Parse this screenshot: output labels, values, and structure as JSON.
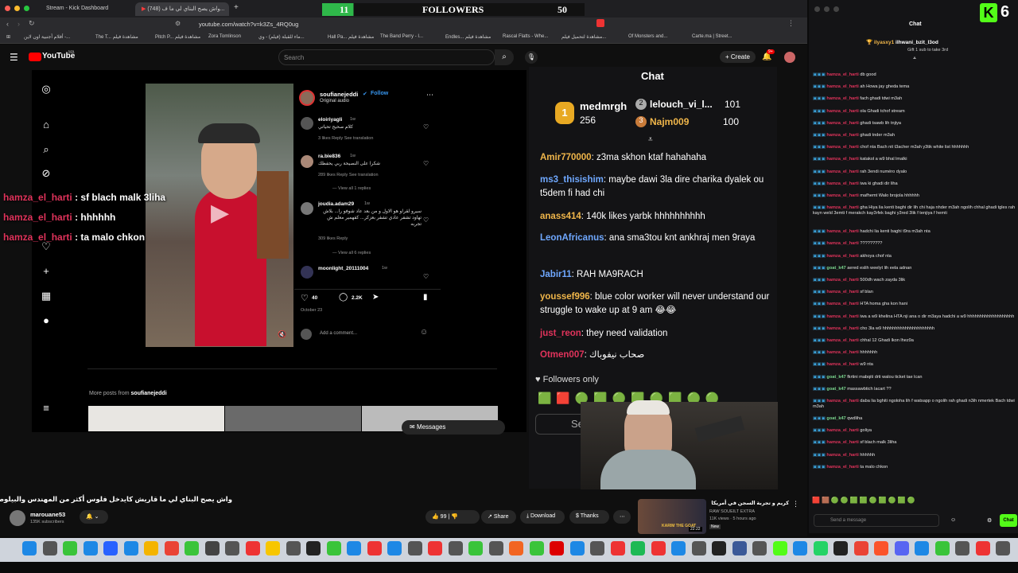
{
  "browser": {
    "tabs": [
      "Stream - Kick Dashboard",
      "(748) واش يصح البناي لي ما ف..."
    ],
    "url": "youtube.com/watch?v=k3Zs_4RQ0ug",
    "bookmarks": [
      "أفلام أجنبية اون لاين -...",
      "The T... مشاهدة فيلم",
      "Pitch P... مشاهدة فيلم",
      "Zora Tomlinson",
      "ماء للقبلة (فيلم) - وي...",
      "Hall Pa... مشاهدة فيلم",
      "The Band Perry - I...",
      "Endles... مشاهدة فيلم",
      "Rascal Flatts - Whe...",
      "مشاهدة لتحميل فيلم...",
      "Of Monsters and...",
      "Carte.ma | Street..."
    ]
  },
  "followers_bar": {
    "current": "11",
    "label": "FOLLOWERS",
    "goal": "50"
  },
  "youtube": {
    "logo": "YouTube",
    "country": "MA",
    "search_placeholder": "Search",
    "create_label": "Create",
    "notif_count": "9+",
    "video_title": "واش يصح البناي لي ما قاريش كايدخل فلوس أكثر من المهندس والبيلوط في مريكان ؟",
    "channel": "marouane53",
    "subscribers": "135K subscribers",
    "likes": "99",
    "share_label": "Share",
    "download_label": "Download",
    "thanks_label": "Thanks",
    "reco_title": "كريم و تجربة السجن في أمريكا",
    "reco_channel": "RAW SOUEILT EXTRA",
    "reco_meta": "11K views · 5 hours ago",
    "reco_badge": "New",
    "reco_duration": "22:22",
    "reco_thumb_text": "KARIM THE GOAT"
  },
  "instagram": {
    "author": "soufianejeddi",
    "follow": "Follow",
    "audio": "Original audio",
    "comments": [
      {
        "user": "eloiriyagli",
        "time": "1w",
        "text": "كلام صحيح تحياتي",
        "meta": "3 likes  Reply  See translation"
      },
      {
        "user": "ra.bie836",
        "time": "1w",
        "text": "شكرا على النصيحة ربي يحفظك",
        "meta": "289 likes  Reply  See translation"
      },
      {
        "user": "joudia.adam29",
        "time": "1w",
        "text": "سيرو لقراو هو الاول و من بعد عاد شوفو را... بلاش تهاود تشفر عادي تشفر بعزكر... كفهمير معلم ش تجربه",
        "meta": "309 likes  Reply"
      },
      {
        "user": "moonlight_20111004",
        "time": "1w",
        "text": "",
        "meta": ""
      }
    ],
    "view_replies_1": "View all 1 replies",
    "view_replies_2": "View all 6 replies",
    "likes": "40",
    "comments_count": "2.2K",
    "date": "October 23",
    "add_comment": "Add a comment...",
    "more_posts": "More posts from",
    "more_posts_user": "soufianejeddi",
    "messages": "Messages"
  },
  "overlay_chat": [
    {
      "user": "hamza_el_harti",
      "text": ": sf blach malk 3liha"
    },
    {
      "user": "hamza_el_harti",
      "text": ": hhhhhh"
    },
    {
      "user": "hamza_el_harti",
      "text": ": ta malo chkon"
    }
  ],
  "kick_chat": {
    "title": "Chat",
    "top1": {
      "rank": "1",
      "name": "medmrgh",
      "amount": "256"
    },
    "top2": {
      "rank": "2",
      "name": "lelouch_vi_l...",
      "amount": "101"
    },
    "top3": {
      "rank": "3",
      "name": "Najm009",
      "amount": "100"
    },
    "messages": [
      {
        "user": "Amir770000",
        "text": ": z3ma skhon ktaf hahahaha",
        "color": "#f0b64a"
      },
      {
        "user": "ms3_thisishim",
        "text": ": maybe dawi 3la dire charika dyalek ou t5dem fi had chi",
        "color": "#6fa8ff"
      },
      {
        "user": "anass414",
        "text": ": 140k likes yarbk hhhhhhhhhh",
        "color": "#f0b64a"
      },
      {
        "user": "LeonAfricanus",
        "text": ": ana sma3tou knt ankhraj men 9raya",
        "color": "#6fa8ff"
      },
      {
        "user": "Jabir11",
        "text": ": RAH MA9RACH",
        "color": "#6fa8ff"
      },
      {
        "user": "youssef996",
        "text": ": blue color worker will never understand our struggle to wake up at 9 am 😂😂",
        "color": "#f0b64a"
      },
      {
        "user": "just_reon",
        "text": ": they need validation",
        "color": "#e0335b"
      },
      {
        "user": "Otmen007",
        "text": ": صحاب نيفوباك",
        "color": "#e0335b"
      }
    ],
    "followers_only": "Followers only",
    "send_placeholder": "Send a"
  },
  "dashboard": {
    "title": "Chat",
    "logo": "6",
    "gift_user": "ilyasxy1",
    "gift_user2": "ilhwani_bzit_l3od",
    "gift_text": "Gift 1 sub to take 3rd",
    "send_placeholder": "Send a message",
    "chat_button": "Chat",
    "messages": [
      {
        "u": "hamza_el_harti",
        "t": "db good"
      },
      {
        "u": "hamza_el_harti",
        "t": "ah Howa jay gheda tema"
      },
      {
        "u": "hamza_el_harti",
        "t": "fach ghadi tdwi m3ah"
      },
      {
        "u": "hamza_el_harti",
        "t": "ola Ghadi tchof stream"
      },
      {
        "u": "hamza_el_harti",
        "t": "ghadi tsawb lih tnjiya"
      },
      {
        "u": "hamza_el_harti",
        "t": "ghadi tnder m3ah"
      },
      {
        "u": "hamza_el_harti",
        "t": "chof nta Bach nit t3acher m3ah y3tik white list hhhhhhh"
      },
      {
        "u": "hamza_el_harti",
        "t": "katakol a w9 bhal lmalki"
      },
      {
        "u": "hamza_el_harti",
        "t": "rah 3endi numéro dyalo"
      },
      {
        "u": "hamza_el_harti",
        "t": "iwa ki ghadi dir liha"
      },
      {
        "u": "hamza_el_harti",
        "t": "mafhemt Walo brojola hhhhhh"
      },
      {
        "u": "hamza_el_harti",
        "t": "gha Hiya lia kenti baghi dir lih chi haja nhder m3ah ngolih chhal ghadi tgles rah kayn weld 3emti f merakch kay3rfek baghi y3red 3lik f tenjiya f hemti"
      },
      {
        "u": "hamza_el_harti",
        "t": "hadchi lia kenti baghi t9ra m3ah nta"
      },
      {
        "u": "hamza_el_harti",
        "t": "?????????"
      },
      {
        "u": "hamza_el_harti",
        "t": "akhoya chof nta"
      },
      {
        "u": "goat_k47",
        "t": "aered eslih weelyt lih eela adnan"
      },
      {
        "u": "hamza_el_harti",
        "t": "500dh wach zayda 3lik"
      },
      {
        "u": "hamza_el_harti",
        "t": "sf blan"
      },
      {
        "u": "hamza_el_harti",
        "t": "HTA homa gha kon hani"
      },
      {
        "u": "hamza_el_harti",
        "t": "iwa a w9 khelina HTA nji ana o dir m3aya hadchi a w9 hhhhhhhhhhhhhhhhhhh"
      },
      {
        "u": "hamza_el_harti",
        "t": "cho 3la w9 hhhhhhhhhhhhhhhhhhhhh"
      },
      {
        "u": "hamza_el_harti",
        "t": "chhal 12 Ghadi lkon lhez9a"
      },
      {
        "u": "hamza_el_harti",
        "t": "hhhhhhh"
      },
      {
        "u": "hamza_el_harti",
        "t": "w9 nta"
      },
      {
        "u": "goat_k47",
        "t": "fkrtini mabqiti drti walou ticket tae lcan"
      },
      {
        "u": "goat_k47",
        "t": "massawbtich lacart ??"
      },
      {
        "u": "hamza_el_harti",
        "t": "daba lia bghiti ngoloha lih f watsapp o ngolih rah ghadi n3ih nmertek Bach tdwi m3ah"
      },
      {
        "u": "goat_k47",
        "t": "qwdliha"
      },
      {
        "u": "hamza_el_harti",
        "t": "goliya"
      },
      {
        "u": "hamza_el_harti",
        "t": "sf blach malk 3liha"
      },
      {
        "u": "hamza_el_harti",
        "t": "hhhhhh"
      },
      {
        "u": "hamza_el_harti",
        "t": "ta malo chkon"
      }
    ]
  }
}
